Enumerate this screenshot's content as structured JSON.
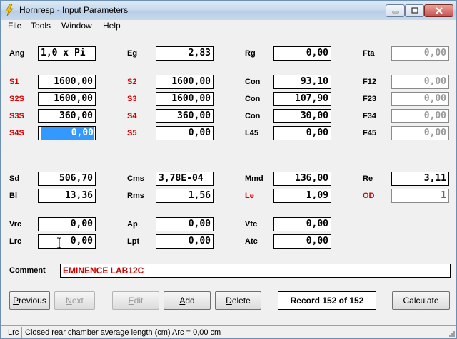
{
  "window": {
    "title": "Hornresp - Input Parameters"
  },
  "menu": [
    "File",
    "Tools",
    "Window",
    "Help"
  ],
  "fields": {
    "ang": {
      "label": "Ang",
      "value": "1,0 x Pi"
    },
    "eg": {
      "label": "Eg",
      "value": "2,83"
    },
    "rg": {
      "label": "Rg",
      "value": "0,00"
    },
    "fta": {
      "label": "Fta",
      "value": "0,00"
    },
    "s1": {
      "label": "S1",
      "value": "1600,00"
    },
    "s2": {
      "label": "S2",
      "value": "1600,00"
    },
    "con1": {
      "label": "Con",
      "value": "93,10"
    },
    "f12": {
      "label": "F12",
      "value": "0,00"
    },
    "s2s": {
      "label": "S2S",
      "value": "1600,00"
    },
    "s3": {
      "label": "S3",
      "value": "1600,00"
    },
    "con2": {
      "label": "Con",
      "value": "107,90"
    },
    "f23": {
      "label": "F23",
      "value": "0,00"
    },
    "s3s": {
      "label": "S3S",
      "value": "360,00"
    },
    "s4": {
      "label": "S4",
      "value": "360,00"
    },
    "con3": {
      "label": "Con",
      "value": "30,00"
    },
    "f34": {
      "label": "F34",
      "value": "0,00"
    },
    "s4s": {
      "label": "S4S",
      "value": "0,00"
    },
    "s5": {
      "label": "S5",
      "value": "0,00"
    },
    "l45": {
      "label": "L45",
      "value": "0,00"
    },
    "f45": {
      "label": "F45",
      "value": "0,00"
    },
    "sd": {
      "label": "Sd",
      "value": "506,70"
    },
    "cms": {
      "label": "Cms",
      "value": "3,78E-04"
    },
    "mmd": {
      "label": "Mmd",
      "value": "136,00"
    },
    "re": {
      "label": "Re",
      "value": "3,11"
    },
    "bl": {
      "label": "Bl",
      "value": "13,36"
    },
    "rms": {
      "label": "Rms",
      "value": "1,56"
    },
    "le": {
      "label": "Le",
      "value": "1,09"
    },
    "od": {
      "label": "OD",
      "value": "1"
    },
    "vrc": {
      "label": "Vrc",
      "value": "0,00"
    },
    "ap": {
      "label": "Ap",
      "value": "0,00"
    },
    "vtc": {
      "label": "Vtc",
      "value": "0,00"
    },
    "lrc": {
      "label": "Lrc",
      "value": "0,00"
    },
    "lpt": {
      "label": "Lpt",
      "value": "0,00"
    },
    "atc": {
      "label": "Atc",
      "value": "0,00"
    }
  },
  "comment": {
    "label": "Comment",
    "value": "EMINENCE LAB12C"
  },
  "buttons": {
    "previous": {
      "hot": "P",
      "rest": "revious"
    },
    "next": {
      "hot": "N",
      "rest": "ext"
    },
    "edit": {
      "hot": "E",
      "rest": "dit"
    },
    "add": {
      "hot": "A",
      "rest": "dd"
    },
    "delete": {
      "hot": "D",
      "rest": "elete"
    },
    "calculate": "Calculate"
  },
  "record": "Record 152 of 152",
  "status": {
    "code": "Lrc",
    "description": "Closed rear chamber average length  (cm)  Arc = 0,00 cm"
  },
  "colors": {
    "required_label": "#d40000",
    "selection": "#3399ff",
    "comment_text": "#d40000"
  }
}
